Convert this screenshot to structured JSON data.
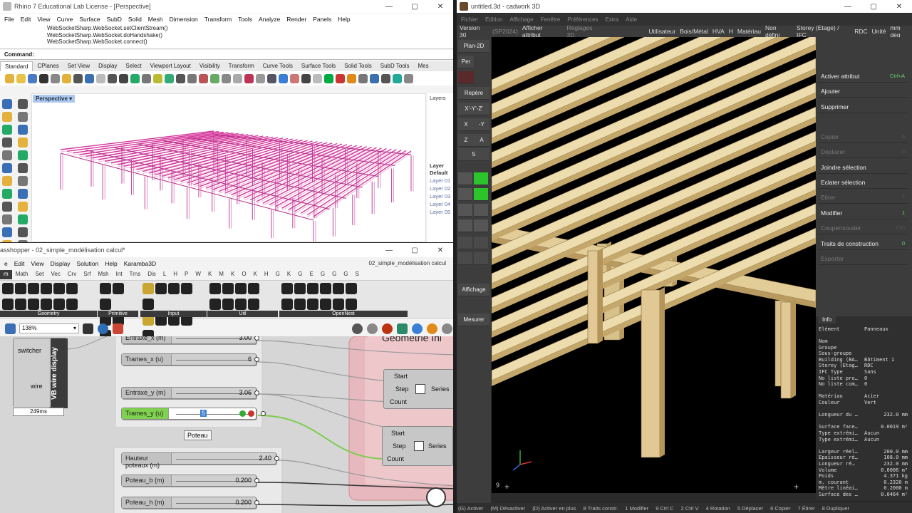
{
  "rhino": {
    "title": "Rhino 7 Educational Lab License - [Perspective]",
    "menu": [
      "File",
      "Edit",
      "View",
      "Curve",
      "Surface",
      "SubD",
      "Solid",
      "Mesh",
      "Dimension",
      "Transform",
      "Tools",
      "Analyze",
      "Render",
      "Panels",
      "Help"
    ],
    "history": [
      "WebSocketSharp.WebSocket.setClientStream()",
      "WebSocketSharp.WebSocket.doHandshake()",
      "WebSocketSharp.WebSocket.connect()"
    ],
    "command_label": "Command:",
    "tabs": [
      "Standard",
      "CPlanes",
      "Set View",
      "Display",
      "Select",
      "Viewport Layout",
      "Visibility",
      "Transform",
      "Curve Tools",
      "Surface Tools",
      "Solid Tools",
      "SubD Tools",
      "Mes"
    ],
    "viewport_label": "Perspective",
    "layers_title": "Layers",
    "layer_header": "Layer",
    "layers": [
      "Default",
      "Layer 01",
      "Layer 02",
      "Layer 03",
      "Layer 04",
      "Layer 05"
    ]
  },
  "gh": {
    "title": "asshopper - 02_simple_modélisation calcul*",
    "menu": [
      "e",
      "Edit",
      "View",
      "Display",
      "Solution",
      "Help",
      "Karamba3D"
    ],
    "doc_name": "02_simple_modélisation calcul",
    "tabs": [
      "m",
      "Math",
      "Set",
      "Vec",
      "Crv",
      "Srf",
      "Msh",
      "Int",
      "Trns",
      "Dis",
      "L",
      "H",
      "P",
      "W",
      "K",
      "M",
      "K",
      "O",
      "K",
      "H",
      "G",
      "K",
      "G",
      "E",
      "G",
      "G",
      "G",
      "S"
    ],
    "groups": [
      "Geometry",
      "Primitive",
      "Input",
      "Util",
      "OpenNest"
    ],
    "zoom": "138%",
    "vb_label": "VB wire display",
    "switcher": "switcher",
    "wire": "wire",
    "timing": "249ms",
    "sliders": [
      {
        "label": "Entraxe_x (m)",
        "value": "3.00"
      },
      {
        "label": "Trames_x (u)",
        "value": "6"
      },
      {
        "label": "Entraxe_y (m)",
        "value": "3.06"
      },
      {
        "label": "Trames_y (u)",
        "value": "5"
      },
      {
        "label": "Hauteur poteaux (m)",
        "value": "2.40"
      },
      {
        "label": "Poteau_b (m)",
        "value": "0.200"
      },
      {
        "label": "Poteau_h (m)",
        "value": "0.200"
      }
    ],
    "group_title": "Geometrie Ini",
    "poteau_label": "Poteau",
    "series": {
      "start": "Start",
      "step": "Step",
      "count": "Count",
      "name": "Series"
    }
  },
  "cad": {
    "title": "untitled.3d - cadwork 3D",
    "menu": [
      "Fichier",
      "Edition",
      "Affichage",
      "Fenêtre",
      "Préférences",
      "Extra",
      "Aide"
    ],
    "toolbar": [
      "Version 30",
      "(SP2024)",
      "Afficher attribut",
      "Réglages 3D",
      "Utilisateur",
      "Bois/Métal",
      "HVA",
      "H",
      "Matériau",
      "Non défini",
      "Storey (Etage) / IFC",
      "RDC",
      "Unité",
      "mm deg"
    ],
    "left": [
      "Plan-2D",
      "Per",
      "Repère",
      "X'-Y'-Z'",
      "X",
      "-Y",
      "Z",
      "A",
      "5",
      "Affichage",
      "Mesurer"
    ],
    "right": [
      {
        "label": "Activer attribut",
        "key": "Ctrl+A",
        "dim": false
      },
      {
        "label": "Ajouter",
        "key": "",
        "dim": false
      },
      {
        "label": "Supprimer",
        "key": "",
        "dim": false
      },
      {
        "label": "Copier",
        "key": "6",
        "dim": true
      },
      {
        "label": "Déplacer",
        "key": "5",
        "dim": true
      },
      {
        "label": "Joindre sélection",
        "key": "",
        "dim": false
      },
      {
        "label": "Eclater sélection",
        "key": "",
        "dim": false
      },
      {
        "label": "Etirer",
        "key": "7",
        "dim": true
      },
      {
        "label": "Modifier",
        "key": "1",
        "dim": false
      },
      {
        "label": "Couper/souder",
        "key": "C/D",
        "dim": true
      },
      {
        "label": "Traits de construction",
        "key": "0",
        "dim": false
      },
      {
        "label": "Exporter",
        "key": "",
        "dim": true
      }
    ],
    "info_tab": "Info",
    "info_head": [
      "Elément",
      "Panneaux"
    ],
    "info_rows": [
      [
        "Nom",
        ""
      ],
      [
        "Groupe",
        ""
      ],
      [
        "Sous-groupe",
        ""
      ],
      [
        "Building (BA…",
        "Bâtiment 1"
      ],
      [
        "Storey (Etag…",
        "RDC"
      ],
      [
        "IFC Type",
        "Sans"
      ],
      [
        "No liste pro…",
        "0"
      ],
      [
        "No liste com…",
        "0"
      ],
      [
        "",
        ""
      ],
      [
        "Matériau",
        "Acier"
      ],
      [
        "Couleur",
        "Vert"
      ],
      [
        "",
        ""
      ],
      [
        "Longueur du …",
        "232.0 mm"
      ],
      [
        "",
        ""
      ],
      [
        "Surface face…",
        "0.0019 m²"
      ],
      [
        "Type extrémi…",
        "Aucun"
      ],
      [
        "Type extrémi…",
        "Aucun"
      ],
      [
        "",
        ""
      ],
      [
        "Largeur réel…",
        "200.0 mm"
      ],
      [
        "Epaisseur ré…",
        "108.0 mm"
      ],
      [
        "Longueur ré…",
        "232.0 mm"
      ],
      [
        "Volume",
        "0.0006 m³"
      ],
      [
        "Poids",
        "4.371 kg"
      ],
      [
        "m. courant",
        "0.2320 m"
      ],
      [
        "Mètre linéai…",
        "0.2000 m"
      ],
      [
        "Surface des …",
        "0.0464 m²"
      ]
    ],
    "status": [
      "(G) Activer",
      "(M) Désactiver",
      "(D) Activer en plus",
      "8 Traits constr.",
      "1 Modifier",
      "9 Ctrl C",
      "2 Ctrl V",
      "4 Rotation",
      "5 Déplacer",
      "6 Copier",
      "7 Étirer",
      "8 Dupliquer"
    ],
    "corner": "9"
  }
}
